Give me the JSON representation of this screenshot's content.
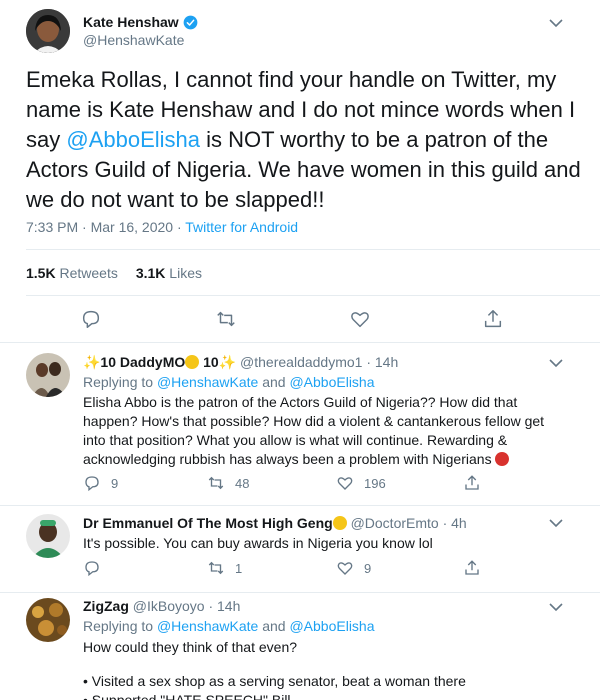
{
  "tweet": {
    "author_name": "Kate Henshaw",
    "author_handle": "@HenshawKate",
    "text_before": "Emeka Rollas, I cannot find your handle on Twitter, my name is Kate Henshaw and I do not mince words when I say ",
    "mention": "@AbboElisha",
    "text_after": " is NOT worthy to be a patron of the Actors Guild of Nigeria. We have women in this guild and we do not want to be slapped!!",
    "timestamp": "7:33 PM · Mar 16, 2020 · ",
    "source": "Twitter for Android",
    "retweets_count": "1.5K",
    "retweets_label": "Retweets",
    "likes_count": "3.1K",
    "likes_label": "Likes"
  },
  "replies": [
    {
      "name_prefix": "✨10 ",
      "name": "DaddyMO",
      "name_suffix": " 10✨",
      "handle": "@therealdaddymo1 · 14h",
      "replying_prefix": "Replying to ",
      "replying_to_1": "@HenshawKate",
      "replying_and": " and ",
      "replying_to_2": "@AbboElisha",
      "text": "Elisha Abbo is the patron of the Actors Guild of Nigeria?? How did that happen? How's that possible? How did a violent & cantankerous fellow get into that position? What you allow is what will continue. Rewarding & acknowledging rubbish has always been a problem with Nigerians",
      "replies_count": "9",
      "retweets_count": "48",
      "likes_count": "196"
    },
    {
      "name": "Dr Emmanuel Of The Most High Geng",
      "handle": "@DoctorEmto · 4h",
      "text": "It's possible. You can buy awards in Nigeria you know lol",
      "replies_count": "",
      "retweets_count": "1",
      "likes_count": "9"
    },
    {
      "name": "ZigZag",
      "handle": "@IkBoyoyo · 14h",
      "replying_prefix": "Replying to ",
      "replying_to_1": "@HenshawKate",
      "replying_and": " and ",
      "replying_to_2": "@AbboElisha",
      "text_line1": "How could they think of that even?",
      "text_line2": "• Visited a sex shop as a serving senator, beat a woman there",
      "text_line3": "• Supported \"HATE SPEECH\" Bill"
    }
  ],
  "colors": {
    "accent": "#1da1f2",
    "muted": "#657786",
    "text": "#14171a",
    "divider": "#e6ecf0",
    "retweet_green": "#17bf63"
  },
  "icons": [
    "verified-badge-icon",
    "chevron-down-icon",
    "reply-icon",
    "retweet-icon",
    "like-icon",
    "share-icon",
    "crown-emoji-icon",
    "sunglasses-emoji-icon",
    "angry-emoji-icon"
  ]
}
